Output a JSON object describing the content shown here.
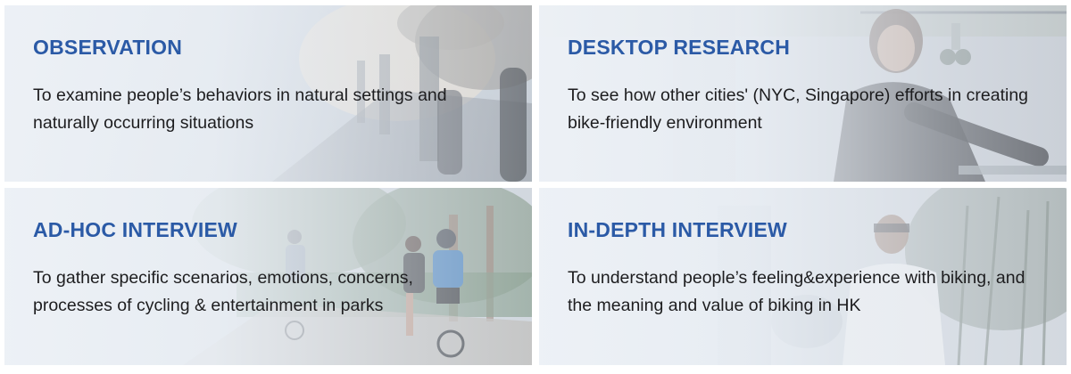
{
  "colors": {
    "title": "#2b5aa6",
    "text": "#1d1d1f"
  },
  "cards": [
    {
      "title": "OBSERVATION",
      "description": "To examine people’s behaviors in natural settings and naturally occurring situations"
    },
    {
      "title": "DESKTOP RESEARCH",
      "description": "To see how other cities' (NYC, Singapore) efforts in creating bike-friendly environment"
    },
    {
      "title": "AD-HOC INTERVIEW",
      "description": "To gather specific scenarios, emotions, concerns, processes of cycling & entertainment in parks"
    },
    {
      "title": "IN-DEPTH INTERVIEW",
      "description": "To understand people’s feeling&experience with biking, and the meaning and value of biking in HK"
    }
  ]
}
